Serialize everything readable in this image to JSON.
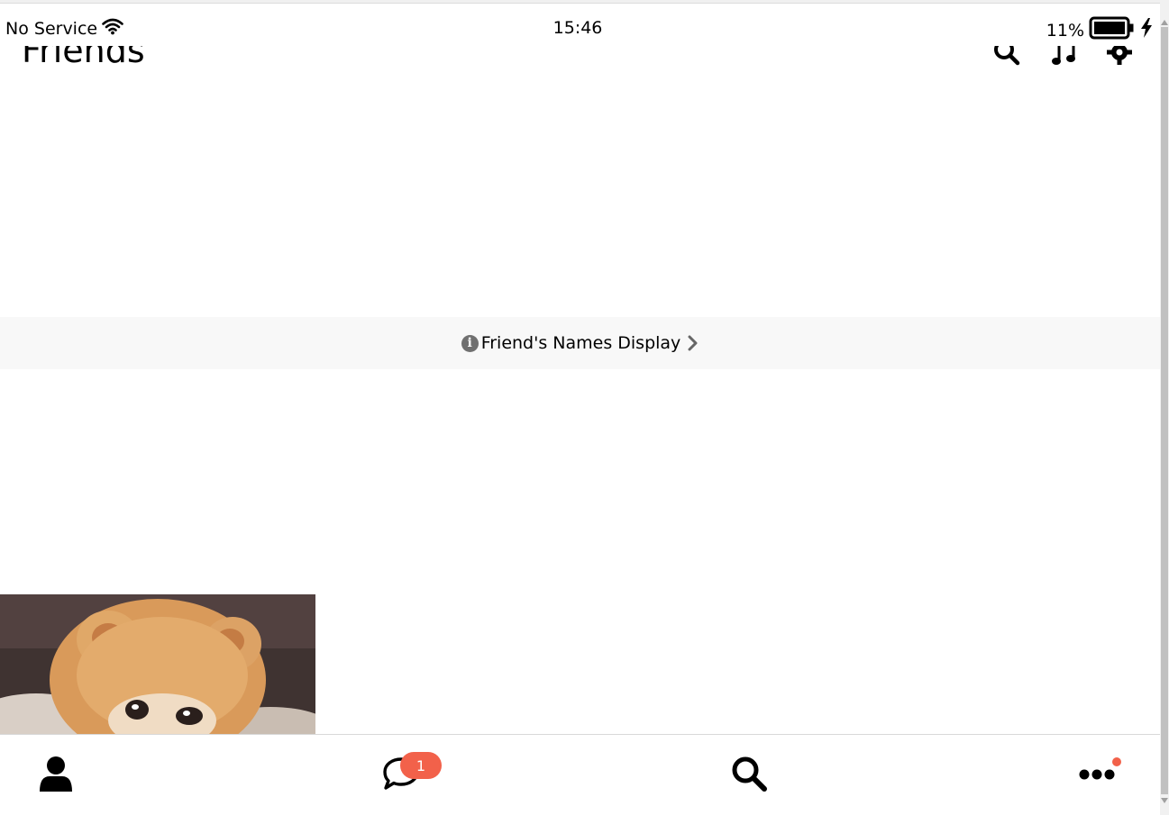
{
  "status_bar": {
    "carrier": "No Service",
    "time": "15:46",
    "battery_percent": "11%",
    "battery_level": 0.11,
    "charging_icon": "lightning-bolt-icon",
    "wifi_icon": "wifi-icon"
  },
  "header": {
    "title": "Friends",
    "icons": [
      "search-icon",
      "music-note-icon",
      "settings-gear-icon"
    ]
  },
  "banner": {
    "info_icon": "info-icon",
    "label": "Friend's Names Display",
    "chevron_icon": "chevron-right-icon"
  },
  "tab_bar": {
    "tabs": [
      {
        "icon": "person-icon",
        "name": "friends"
      },
      {
        "icon": "chat-bubble-icon",
        "name": "chats",
        "badge": "1"
      },
      {
        "icon": "search-icon",
        "name": "search"
      },
      {
        "icon": "more-dots-icon",
        "name": "more",
        "dot": true
      }
    ],
    "badge_color": "#f2614a"
  },
  "colors": {
    "banner_background": "#f8f8f8",
    "badge": "#f2614a",
    "icon": "#000000"
  }
}
